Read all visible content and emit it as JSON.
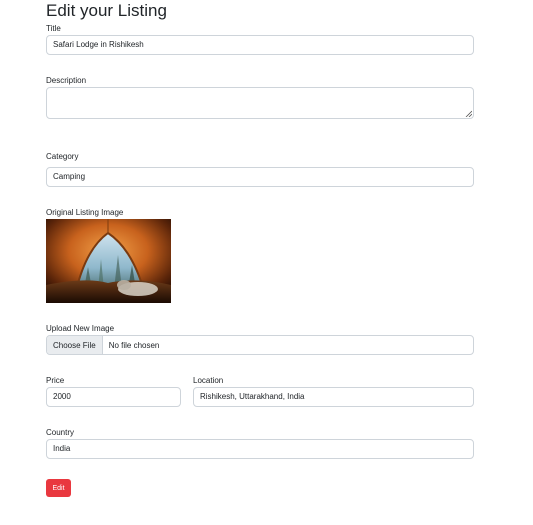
{
  "page": {
    "heading": "Edit your Listing"
  },
  "form": {
    "title_label": "Title",
    "title_value": "Safari Lodge in Rishikesh",
    "description_label": "Description",
    "description_value": "",
    "category_label": "Category",
    "category_value": "Camping",
    "original_image_label": "Original Listing Image",
    "upload_label": "Upload New Image",
    "choose_file_label": "Choose File",
    "file_status": "No file chosen",
    "price_label": "Price",
    "price_value": "2000",
    "location_label": "Location",
    "location_value": "Rishikesh, Uttarakhand, India",
    "country_label": "Country",
    "country_value": "India",
    "submit_label": "Edit"
  },
  "colors": {
    "submit_button": "#e9383f",
    "input_border": "#ced4da",
    "file_button_bg": "#e9ecef"
  },
  "icons": {
    "textarea_resize": "resize-grip-icon"
  }
}
